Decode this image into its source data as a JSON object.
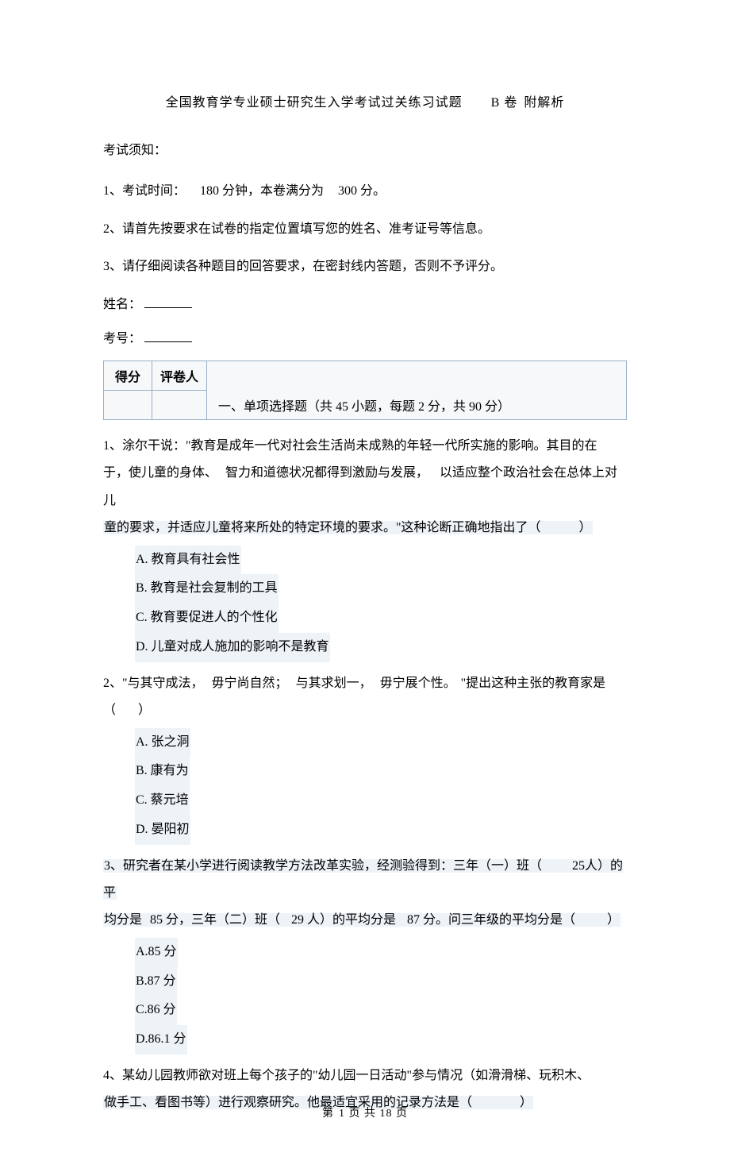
{
  "title": {
    "part1": "全国教育学专业硕士研究生入学考试过关练习试题",
    "part2": "B 卷",
    "part3": "附解析"
  },
  "notice_label": "考试须知：",
  "notices": [
    {
      "prefix": "1、考试时间：",
      "mid1": "180 分钟，本卷满分为",
      "mid2": "300 分。"
    },
    {
      "text": "2、请首先按要求在试卷的指定位置填写您的姓名、准考证号等信息。"
    },
    {
      "text": "3、请仔细阅读各种题目的回答要求，在密封线内答题，否则不予评分。"
    }
  ],
  "fields": {
    "name_label": "姓名：",
    "id_label": "考号："
  },
  "score_headers": {
    "score": "得分",
    "marker": "评卷人"
  },
  "section_heading": "一、单项选择题（共   45 小题，每题  2 分，共  90 分）",
  "q1": {
    "l1": "1、涂尔干说：\"教育是成年一代对社会生活尚未成熟的年轻一代所实施的影响。其目的在",
    "l2a": "于，使儿童的身体、",
    "l2b": "智力和道德状况都得到激励与发展，",
    "l2c": "以适应整个政治社会在总体上对儿",
    "l3": "童的要求，并适应儿童将来所处的特定环境的要求。\"这种论断正确地指出了（",
    "l3_close": "）",
    "opts": {
      "A": "A. 教育具有社会性",
      "B": "B. 教育是社会复制的工具",
      "C": "C. 教育要促进人的个性化",
      "D": "D. 儿童对成人施加的影响不是教育"
    }
  },
  "q2": {
    "l1a": "2、\"与其守成法，",
    "l1b": "毋宁尚自然；",
    "l1c": "与其求划一，",
    "l1d": "毋宁展个性。",
    "l1e": "\"提出这种主张的教育家是",
    "l1_open": "（",
    "l1_close": "）",
    "opts": {
      "A": "A. 张之洞",
      "B": "B. 康有为",
      "C": "C. 蔡元培",
      "D": "D. 晏阳初"
    }
  },
  "q3": {
    "l1a": "3、研究者在某小学进行阅读教学方法改革实验，经测验得到：三年（一）班（",
    "l1b": "25人）的平",
    "l2a": "均分是",
    "l2b": "85 分，三年（二）班（",
    "l2c": "29 人）的平均分是",
    "l2d": "87 分。问三年级的平均分是（",
    "l2_close": "）",
    "opts": {
      "A": "A.85  分",
      "B": "B.87  分",
      "C": "C.86  分",
      "D": "D.86.1   分"
    }
  },
  "q4": {
    "l1": "4、某幼儿园教师欲对班上每个孩子的\"幼儿园一日活动\"参与情况（如滑滑梯、玩积木、",
    "l2a": "做手工、看图书等）进行观察研究。他最适宜采用的记录方法是（",
    "l2_close": "）"
  },
  "footer": {
    "a": "第",
    "b": "1 页 共 18 页"
  }
}
